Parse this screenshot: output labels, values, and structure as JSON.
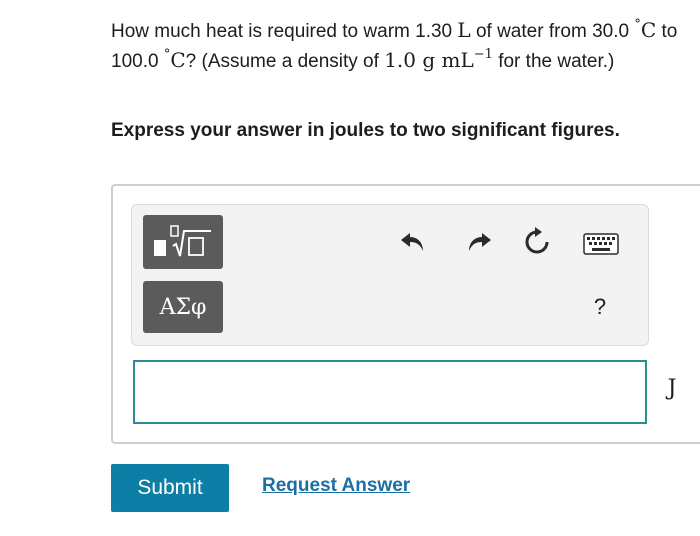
{
  "question": {
    "part1": "How much heat is required to warm 1.30 ",
    "volume_unit": "L",
    "part2": " of water from 30.0 ",
    "degree1": "°",
    "temp_unit1": "C",
    "part3": " to 100.0 ",
    "degree2": "°",
    "temp_unit2": "C",
    "part4": "? (Assume a density of ",
    "density_value": "1.0 g mL",
    "density_exponent": "−1",
    "part5": " for the water.)"
  },
  "instruction": "Express your answer in joules to two significant figures.",
  "toolbar": {
    "templates_icon": "templates-sqrt-icon",
    "symbols_label": "ΑΣφ",
    "undo_icon": "undo-icon",
    "redo_icon": "redo-icon",
    "reset_icon": "reset-icon",
    "keyboard_icon": "keyboard-icon",
    "help_label": "?"
  },
  "answer": {
    "value": "",
    "unit": "J"
  },
  "actions": {
    "submit_label": "Submit",
    "request_answer_label": "Request Answer"
  },
  "colors": {
    "submit_bg": "#0d7fa6",
    "link": "#1a6fa3",
    "input_border": "#2b8a94",
    "tool_button": "#5b5b5b"
  }
}
